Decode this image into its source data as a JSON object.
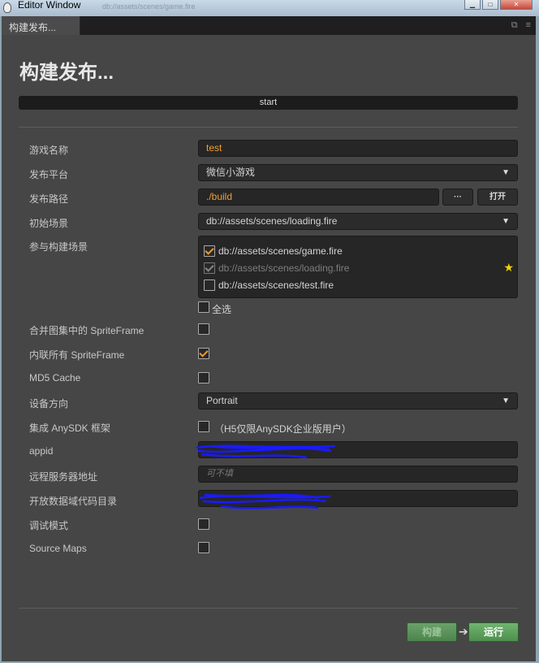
{
  "window": {
    "title": "Editor Window",
    "ghost_path": "db://assets/scenes/game.fire",
    "min_icon": "minimize-icon",
    "max_icon": "maximize-icon",
    "close_icon": "close-icon"
  },
  "tab": {
    "label": "构建发布..."
  },
  "panel": {
    "heading": "构建发布...",
    "start_label": "start"
  },
  "form": {
    "game_name": {
      "label": "游戏名称",
      "value": "test"
    },
    "platform": {
      "label": "发布平台",
      "value": "微信小游戏"
    },
    "build_path": {
      "label": "发布路径",
      "value": "./build",
      "browse_label": "···",
      "open_label": "打开"
    },
    "start_scene": {
      "label": "初始场景",
      "value": "db://assets/scenes/loading.fire"
    },
    "included_scenes": {
      "label": "参与构建场景",
      "items": [
        {
          "name": "db://assets/scenes/game.fire",
          "checked": true
        },
        {
          "name": "db://assets/scenes/loading.fire",
          "checked": true,
          "disabled": true
        },
        {
          "name": "db://assets/scenes/test.fire",
          "checked": false
        }
      ],
      "select_all_label": "全选"
    },
    "merge_sprite": {
      "label": "合并图集中的 SpriteFrame",
      "checked": false
    },
    "inline_sprite": {
      "label": "内联所有 SpriteFrame",
      "checked": true
    },
    "md5_cache": {
      "label": "MD5 Cache",
      "checked": false
    },
    "orientation": {
      "label": "设备方向",
      "value": "Portrait"
    },
    "anysdk": {
      "label": "集成 AnySDK 框架",
      "note": "（H5仅限AnySDK企业版用户）",
      "checked": false
    },
    "appid": {
      "label": "appid"
    },
    "remote_server": {
      "label": "远程服务器地址",
      "placeholder": "可不填"
    },
    "open_data": {
      "label": "开放数据域代码目录"
    },
    "debug": {
      "label": "调试模式",
      "checked": false
    },
    "source_maps": {
      "label": "Source Maps",
      "checked": false
    }
  },
  "footer": {
    "build_label": "构建",
    "run_label": "运行"
  },
  "colors": {
    "accent": "#f09a2a",
    "panel_bg": "#464646",
    "run_green": "#5a9e5a",
    "scribble_blue": "#1a1aff"
  }
}
